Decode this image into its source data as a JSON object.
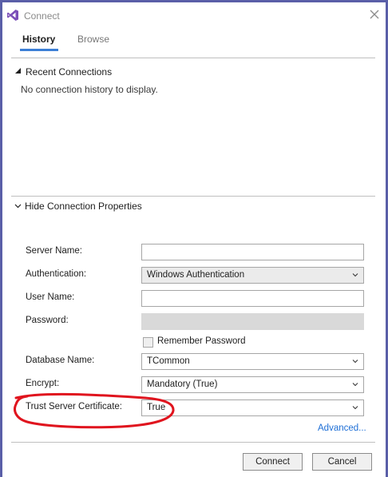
{
  "window": {
    "title": "Connect"
  },
  "tabs": [
    {
      "label": "History",
      "active": true
    },
    {
      "label": "Browse",
      "active": false
    }
  ],
  "recent": {
    "heading": "Recent Connections",
    "empty_message": "No connection history to display."
  },
  "properties": {
    "heading": "Hide Connection Properties",
    "server_name": {
      "label": "Server Name:",
      "value": ""
    },
    "authentication": {
      "label": "Authentication:",
      "value": "Windows Authentication"
    },
    "user_name": {
      "label": "User Name:",
      "value": ""
    },
    "password": {
      "label": "Password:",
      "value": ""
    },
    "remember_password": {
      "label": "Remember Password",
      "checked": false
    },
    "database_name": {
      "label": "Database Name:",
      "value": "TCommon"
    },
    "encrypt": {
      "label": "Encrypt:",
      "value": "Mandatory (True)"
    },
    "trust_server_certificate": {
      "label": "Trust Server Certificate:",
      "value": "True"
    },
    "advanced_link": "Advanced..."
  },
  "buttons": {
    "connect": "Connect",
    "cancel": "Cancel"
  },
  "colors": {
    "accent": "#3c7fd6",
    "annotation": "#e0141e",
    "frame": "#5a5fa8"
  },
  "icons": {
    "app": "visual-studio-icon",
    "close": "close-icon"
  }
}
